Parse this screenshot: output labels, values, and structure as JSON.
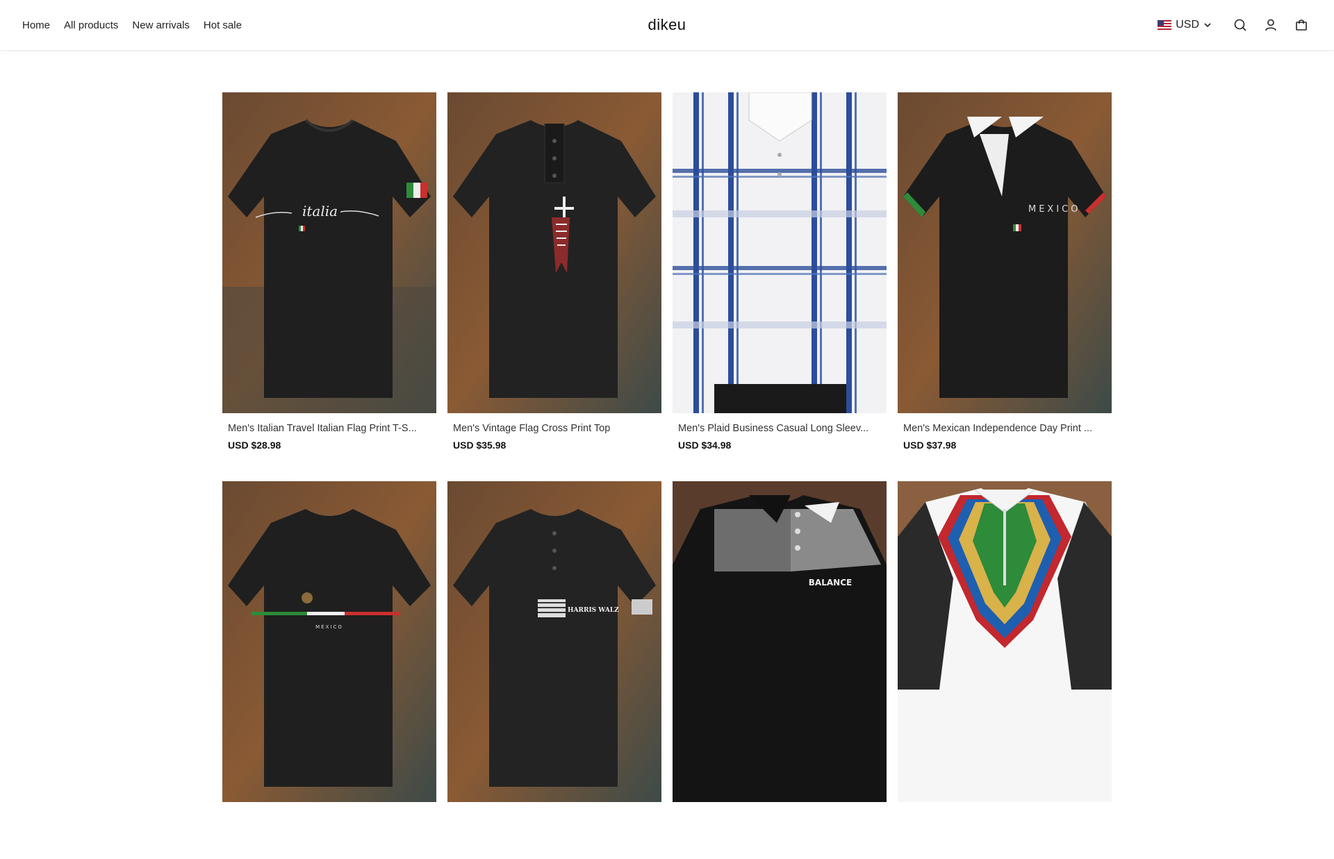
{
  "header": {
    "nav": [
      "Home",
      "All products",
      "New arrivals",
      "Hot sale"
    ],
    "brand": "dikeu",
    "currency": "USD",
    "icons": [
      "us-flag-icon",
      "chevron-down-icon",
      "search-icon",
      "account-icon",
      "cart-icon"
    ]
  },
  "products": [
    {
      "title": "Men's Italian Travel Italian Flag Print T-S...",
      "price": "USD $28.98",
      "print": "italia"
    },
    {
      "title": "Men's Vintage Flag Cross Print Top",
      "price": "USD $35.98",
      "print": ""
    },
    {
      "title": "Men's Plaid Business Casual Long Sleev...",
      "price": "USD $34.98",
      "print": ""
    },
    {
      "title": "Men's Mexican Independence Day Print ...",
      "price": "USD $37.98",
      "print": "MEXICO"
    },
    {
      "title": "",
      "price": "",
      "print": "MÉXICO"
    },
    {
      "title": "",
      "price": "",
      "print": "HARRIS WALZ"
    },
    {
      "title": "",
      "price": "",
      "print": "BALANCE"
    },
    {
      "title": "",
      "price": "",
      "print": ""
    }
  ]
}
